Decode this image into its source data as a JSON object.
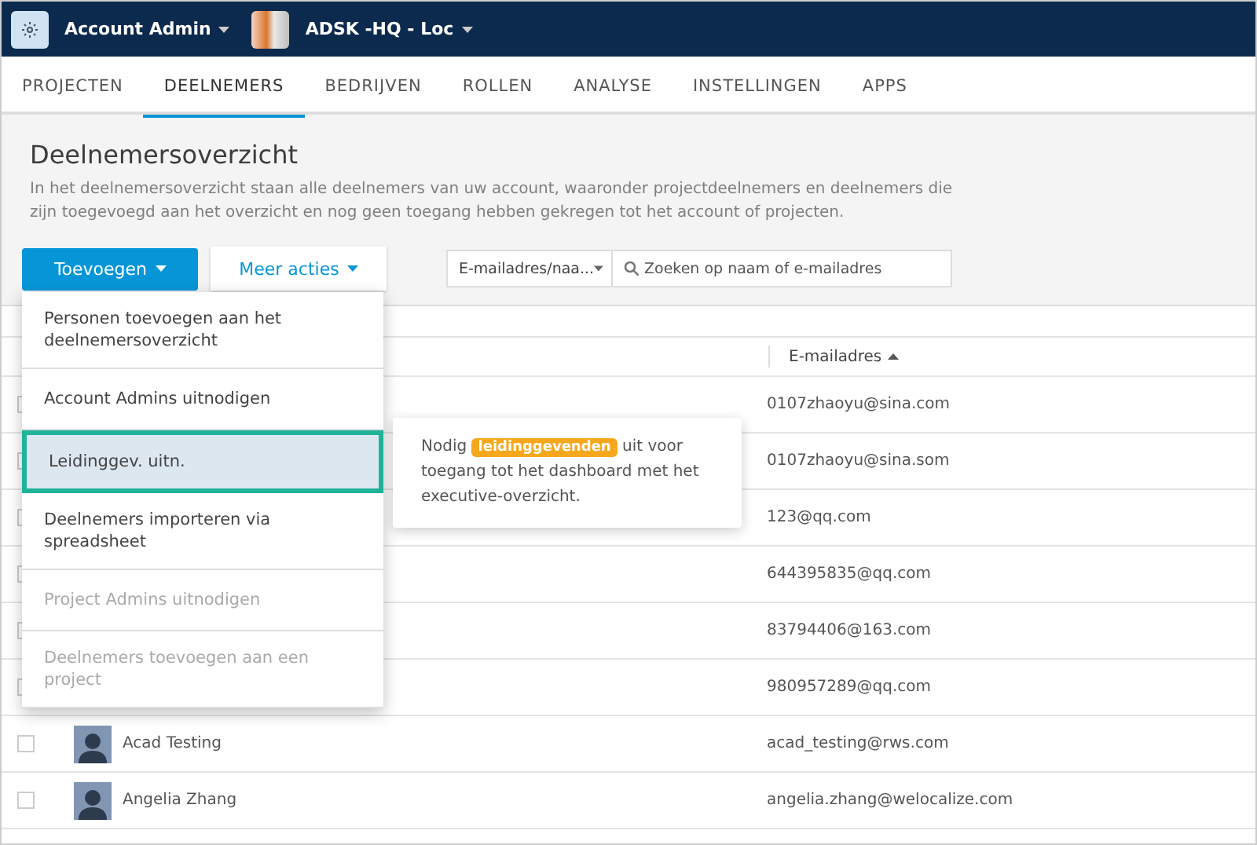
{
  "topbar": {
    "account": "Account Admin",
    "project": "ADSK -HQ - Loc"
  },
  "tabs": [
    {
      "label": "PROJECTEN",
      "selected": false
    },
    {
      "label": "DEELNEMERS",
      "selected": true
    },
    {
      "label": "BEDRIJVEN",
      "selected": false
    },
    {
      "label": "ROLLEN",
      "selected": false
    },
    {
      "label": "ANALYSE",
      "selected": false
    },
    {
      "label": "INSTELLINGEN",
      "selected": false
    },
    {
      "label": "APPS",
      "selected": false
    }
  ],
  "page": {
    "title": "Deelnemersoverzicht",
    "description": "In het deelnemersoverzicht staan alle deelnemers van uw account, waaronder projectdeelnemers en deelnemers die zijn toegevoegd aan het overzicht en nog geen toegang hebben gekregen tot het account of projecten."
  },
  "toolbar": {
    "add_button": "Toevoegen",
    "more_button": "Meer acties",
    "filter": "E-mailadres/naa...",
    "search": {
      "placeholder": "Zoeken op naam of e-mailadres"
    }
  },
  "table": {
    "columns": [
      "E-mailadres"
    ],
    "rows": [
      {
        "checked": false,
        "email": "0107zhaoyu@sina.com"
      },
      {
        "checked": false,
        "email": "0107zhaoyu@sina.som"
      },
      {
        "checked": false,
        "email": "123@qq.com"
      },
      {
        "checked": false,
        "email": "644395835@qq.com"
      },
      {
        "checked": false,
        "email": "83794406@163.com"
      },
      {
        "checked": false,
        "email": "980957289@qq.com"
      },
      {
        "checked": false,
        "name": "Acad Testing",
        "email": "acad_testing@rws.com"
      },
      {
        "checked": false,
        "name": "Angelia Zhang",
        "email": "angelia.zhang@welocalize.com"
      }
    ]
  },
  "dropdown": {
    "items": [
      {
        "label": "Personen toevoegen aan het deelnemersoverzicht",
        "selected": false,
        "disabled": false
      },
      {
        "label": "Account Admins uitnodigen",
        "selected": false,
        "disabled": false
      },
      {
        "label": "Leidinggev. uitn.",
        "selected": true,
        "disabled": false
      },
      {
        "label": "Deelnemers importeren via spreadsheet",
        "selected": false,
        "disabled": false
      },
      {
        "label": "Project Admins uitnodigen",
        "selected": false,
        "disabled": true
      },
      {
        "label": "Deelnemers toevoegen aan een project",
        "selected": false,
        "disabled": true
      }
    ]
  },
  "tooltip": {
    "before": "Nodig",
    "badge": "leidinggevenden",
    "after": "uit voor toegang tot het dashboard met het executive-overzicht."
  }
}
